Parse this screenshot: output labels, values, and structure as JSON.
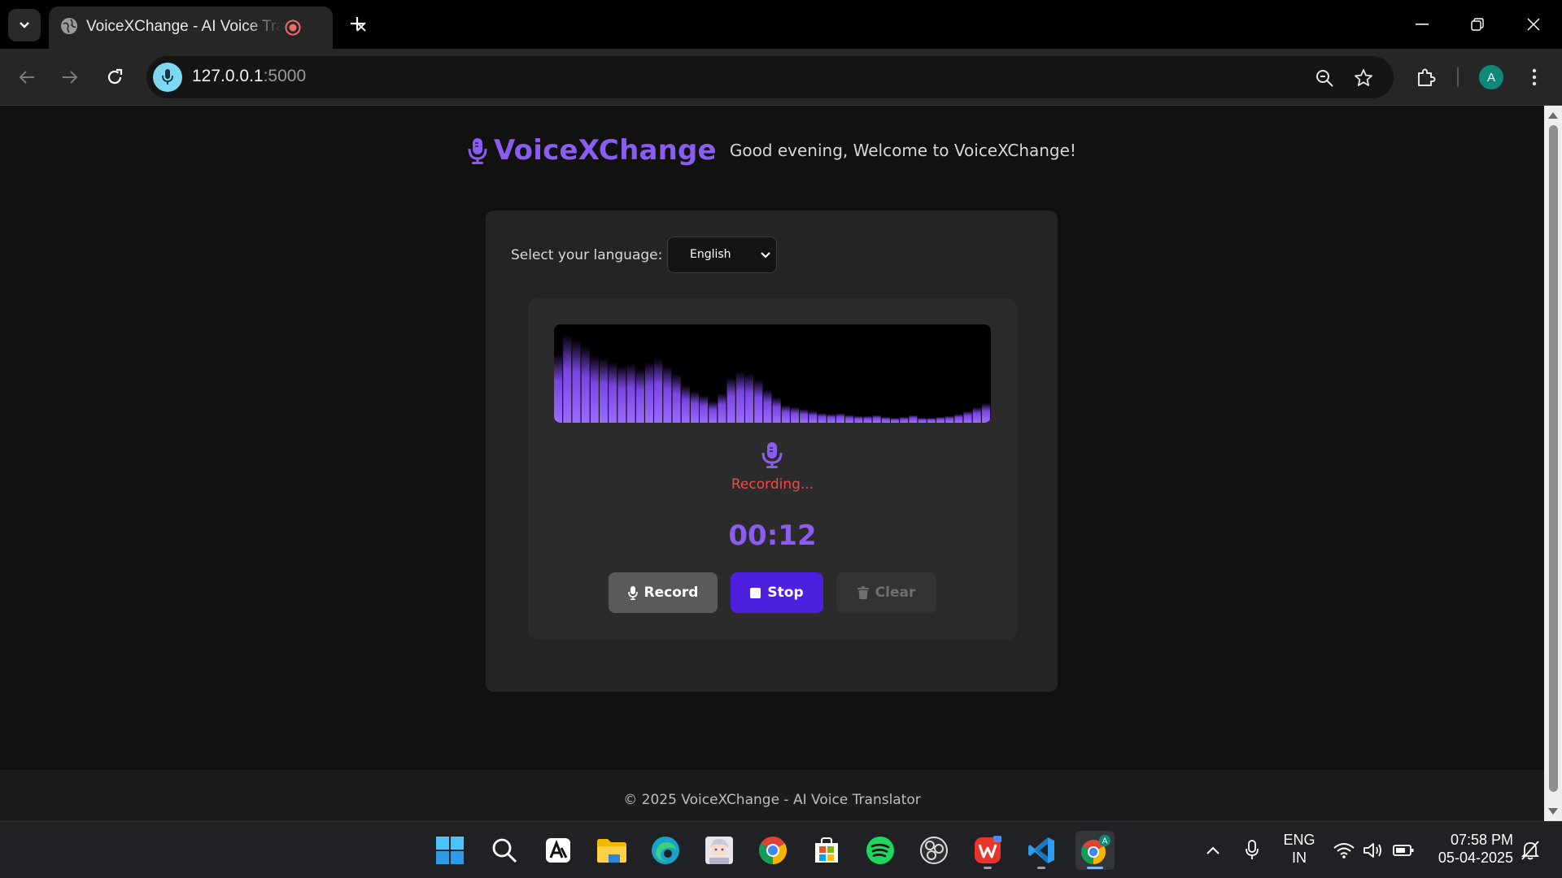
{
  "browser": {
    "tab_title": "VoiceXChange - AI Voice Translator",
    "url_host": "127.0.0.1",
    "url_port": ":5000",
    "profile_initial": "A"
  },
  "app": {
    "brand_name": "VoiceXChange",
    "greeting": "Good evening, Welcome to VoiceXChange!",
    "language_label": "Select your language:",
    "language_selected": "English",
    "recording_status": "Recording...",
    "timer": "00:12",
    "record_label": "Record",
    "stop_label": "Stop",
    "clear_label": "Clear",
    "footer": "© 2025 VoiceXChange - AI Voice Translator",
    "accent_color": "#8c5cf0",
    "stop_color": "#4f1fe0",
    "status_color": "#ef4a4a",
    "visualizer_levels": [
      0.7,
      0.9,
      0.85,
      0.78,
      0.68,
      0.66,
      0.62,
      0.58,
      0.6,
      0.55,
      0.62,
      0.66,
      0.58,
      0.5,
      0.38,
      0.32,
      0.28,
      0.22,
      0.3,
      0.46,
      0.52,
      0.5,
      0.44,
      0.34,
      0.26,
      0.18,
      0.16,
      0.14,
      0.12,
      0.1,
      0.09,
      0.1,
      0.08,
      0.07,
      0.07,
      0.08,
      0.06,
      0.05,
      0.06,
      0.08,
      0.05,
      0.05,
      0.06,
      0.07,
      0.09,
      0.12,
      0.16,
      0.2
    ]
  },
  "taskbar": {
    "apps": [
      "windows-start",
      "search",
      "ai-writer",
      "file-explorer",
      "edge",
      "anime-wallpaper",
      "chrome",
      "microsoft-store",
      "spotify",
      "obs",
      "wps-office",
      "vscode",
      "chrome-profile"
    ],
    "lang_line1": "ENG",
    "lang_line2": "IN",
    "time": "07:58 PM",
    "date": "05-04-2025"
  }
}
